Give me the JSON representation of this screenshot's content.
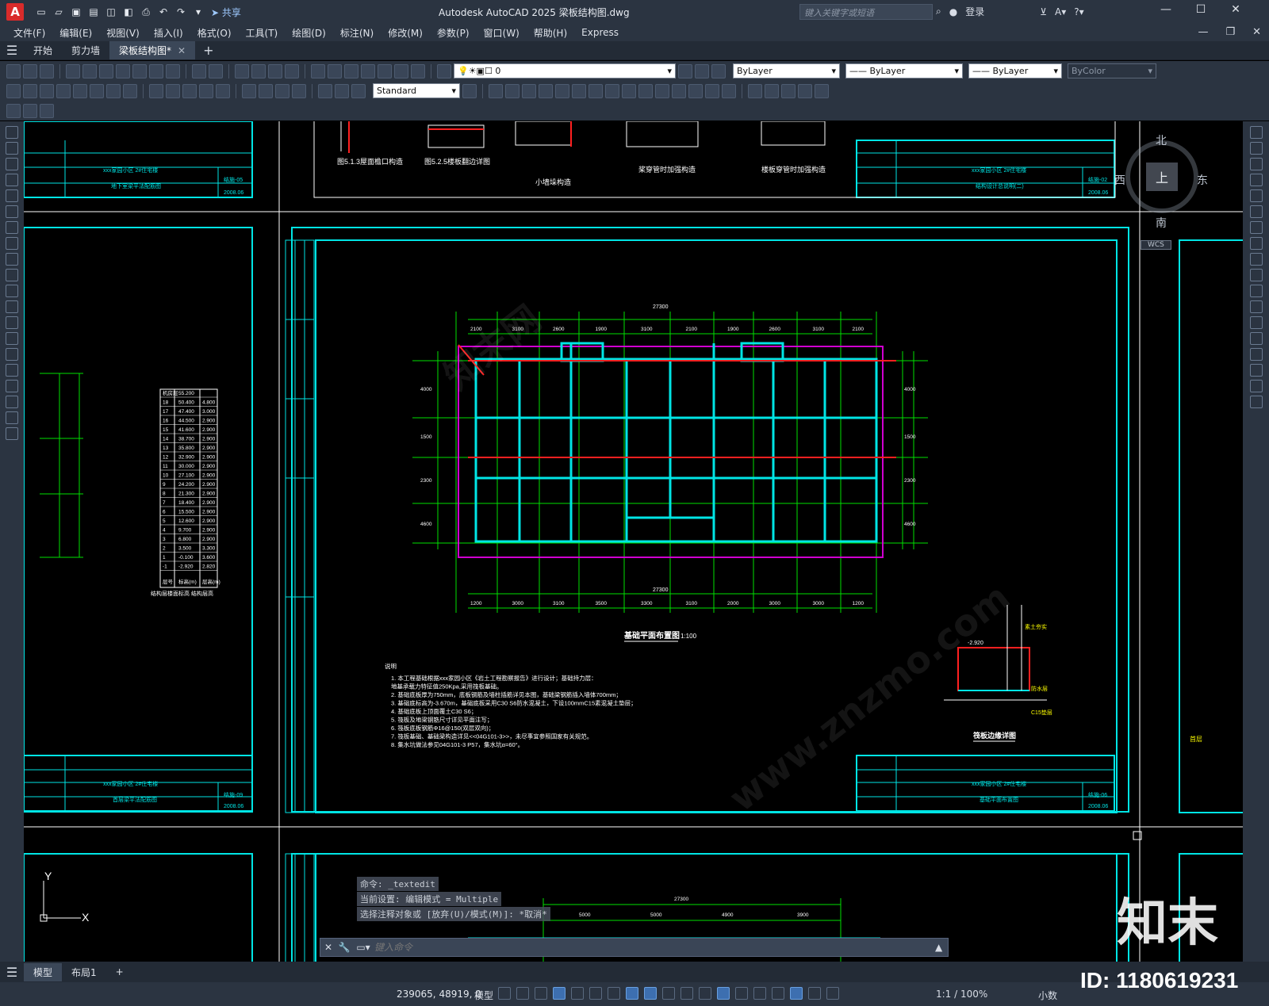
{
  "app": {
    "logo": "A",
    "title": "Autodesk AutoCAD 2025    梁板结构图.dwg",
    "share_label": "共享",
    "search_placeholder": "键入关键字或短语",
    "login_label": "登录"
  },
  "menu": {
    "items": [
      "文件(F)",
      "编辑(E)",
      "视图(V)",
      "插入(I)",
      "格式(O)",
      "工具(T)",
      "绘图(D)",
      "标注(N)",
      "修改(M)",
      "参数(P)",
      "窗口(W)",
      "帮助(H)",
      "Express"
    ]
  },
  "tabs": {
    "items": [
      "开始",
      "剪力墙",
      "梁板结构图*"
    ]
  },
  "toolbar": {
    "layer_name": "0",
    "text_style": "Standard",
    "color_combo": "ByLayer",
    "linetype_combo": "ByLayer",
    "lineweight_combo": "ByLayer",
    "plotstyle_combo": "ByColor"
  },
  "viewcube": {
    "north": "北",
    "south": "南",
    "east": "东",
    "west": "西",
    "top": "上",
    "wcs": "WCS"
  },
  "drawing": {
    "sheets": [
      {
        "project": "xxx家园小区    2#住宅楼",
        "title": "地下室梁平法配筋图",
        "code": "结施-05",
        "date": "2008.06"
      },
      {
        "project": "xxx家园小区    2#住宅楼",
        "title": "结构设计总说明(二)",
        "code": "结施-02",
        "date": "2008.06"
      },
      {
        "project": "xxx家园小区    2#住宅楼",
        "title": "首层梁平法配筋图",
        "code": "结施-09",
        "date": "2008.06"
      },
      {
        "project": "xxx家园小区    2#住宅楼",
        "title": "基础平面布置图",
        "code": "结施-06",
        "date": "2008.06"
      }
    ],
    "top_labels": [
      "图5.1.3屋面檐口构造",
      "图5.2.5楼板翻边详图",
      "小墙垛构造",
      "桨穿管时加强构造",
      "楼板穿管时加强构造"
    ],
    "plan_title": "基础平面布置图",
    "plan_scale": "1:100",
    "overall_dim": "27300",
    "dims_top": [
      "2100",
      "3100",
      "2600",
      "1900",
      "3100",
      "2100",
      "1900",
      "2600",
      "3100",
      "2100"
    ],
    "dims_bottom": [
      "1200",
      "3000",
      "3100",
      "3500",
      "3300",
      "3100",
      "2000",
      "3000",
      "3000",
      "1200"
    ],
    "dims_side": [
      "4000",
      "1500",
      "2300",
      "4600"
    ],
    "detail_title": "筏板边缘详图",
    "detail_labels": [
      "-2.920",
      "C15垫层",
      "防水层",
      "素土夯实"
    ],
    "notes_title": "说明",
    "notes": [
      "1. 本工程基础根据xxx家园小区《岩土工程勘察报告》进行设计；基础持力层：",
      "   地基承载力特征值250Kpa,采用筏板基础。",
      "2. 基础底板厚为750mm，底板钢筋及墙柱插筋详见本图，基础梁钢筋插入墙体700mm；",
      "3. 基础底标高为-3.670m，基础底板采用C30 S6防水混凝土，下设100mmC15素混凝土垫层；",
      "4. 基础底板上顶面覆土C30 S6；",
      "5. 筏板及地梁钢筋尺寸详见平面注写；",
      "6. 筏板底板钢筋Φ16@150(双层双向)；",
      "7. 筏板基础、基础梁构造详见<<04G101-3>>，未尽事宜参照国家有关规范。",
      "8. 集水坑做法参见04G101-3 P57，集水坑α=60°。"
    ],
    "elev_table_title": "结构层楼面标高 结构层高",
    "elev_table_headers": [
      "层号",
      "标高(m)",
      "层高(m)"
    ],
    "elev_table": [
      [
        "机房层",
        "55.200",
        ""
      ],
      [
        "18",
        "50.400",
        "4.800"
      ],
      [
        "17",
        "47.400",
        "3.000"
      ],
      [
        "16",
        "44.500",
        "2.900"
      ],
      [
        "15",
        "41.600",
        "2.900"
      ],
      [
        "14",
        "38.700",
        "2.900"
      ],
      [
        "13",
        "35.800",
        "2.900"
      ],
      [
        "12",
        "32.900",
        "2.900"
      ],
      [
        "11",
        "30.000",
        "2.900"
      ],
      [
        "10",
        "27.100",
        "2.900"
      ],
      [
        "9",
        "24.200",
        "2.900"
      ],
      [
        "8",
        "21.300",
        "2.900"
      ],
      [
        "7",
        "18.400",
        "2.900"
      ],
      [
        "6",
        "15.500",
        "2.900"
      ],
      [
        "5",
        "12.600",
        "2.900"
      ],
      [
        "4",
        "9.700",
        "2.900"
      ],
      [
        "3",
        "6.800",
        "2.900"
      ],
      [
        "2",
        "3.500",
        "3.300"
      ],
      [
        "1",
        "-0.100",
        "3.600"
      ],
      [
        "-1",
        "-2.920",
        "2.820"
      ]
    ],
    "bottom_dims": [
      "27300",
      "5000",
      "5000",
      "4900",
      "3900"
    ],
    "right_sheet_label": "首层"
  },
  "ucs": {
    "x": "X",
    "y": "Y"
  },
  "command": {
    "history": [
      "命令: _textedit",
      "当前设置: 编辑模式 = Multiple",
      "选择注释对象或 [放弃(U)/模式(M)]: *取消*"
    ],
    "placeholder": "键入命令"
  },
  "layout_tabs": {
    "items": [
      "模型",
      "布局1"
    ]
  },
  "status": {
    "coords": "239065, 48919, 0",
    "model": "模型",
    "scale": "1:1 / 100%",
    "units": "小数"
  },
  "watermark": {
    "brand": "知末",
    "id": "ID: 1180619231",
    "site": "www.znzmo.com",
    "site_cn": "知末网"
  },
  "colors": {
    "cyan": "#00e5e5",
    "green": "#00e000",
    "magenta": "#d000d0",
    "red": "#ff2020",
    "white": "#ffffff"
  }
}
